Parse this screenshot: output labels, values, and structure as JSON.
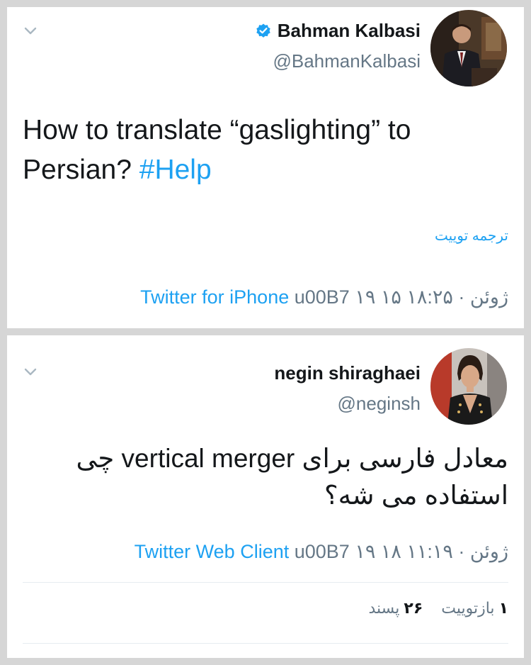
{
  "tweets": [
    {
      "display_name": "Bahman Kalbasi",
      "handle": "@BahmanKalbasi",
      "verified": true,
      "text_main": "How to translate “gaslighting” to Persian? ",
      "hashtag": "#Help",
      "translate_label": "ترجمه توییت",
      "source": "Twitter for iPhone",
      "date_time": "u00B7 ۱۹ ۱۵ ژوئن · ۱۸:۲۵",
      "icons": {
        "menu": "chevron-down-icon",
        "verified": "verified-badge-icon"
      }
    },
    {
      "display_name": "negin shiraghaei",
      "handle": "@neginsh",
      "verified": false,
      "text_main": "معادل فارسی برای vertical merger چی استفاده می شه؟",
      "source": "Twitter Web Client",
      "date_time": "u00B7 ۱۹ ۱۸ ژوئن · ۱۱:۱۹",
      "retweets_count": "۱",
      "retweets_label": "بازتوییت",
      "likes_count": "۲۶",
      "likes_label": "پسند",
      "icons": {
        "menu": "chevron-down-icon"
      }
    }
  ],
  "colors": {
    "background": "#d6d6d6",
    "link": "#1da1f2",
    "text": "#14171a",
    "secondary": "#657786"
  }
}
